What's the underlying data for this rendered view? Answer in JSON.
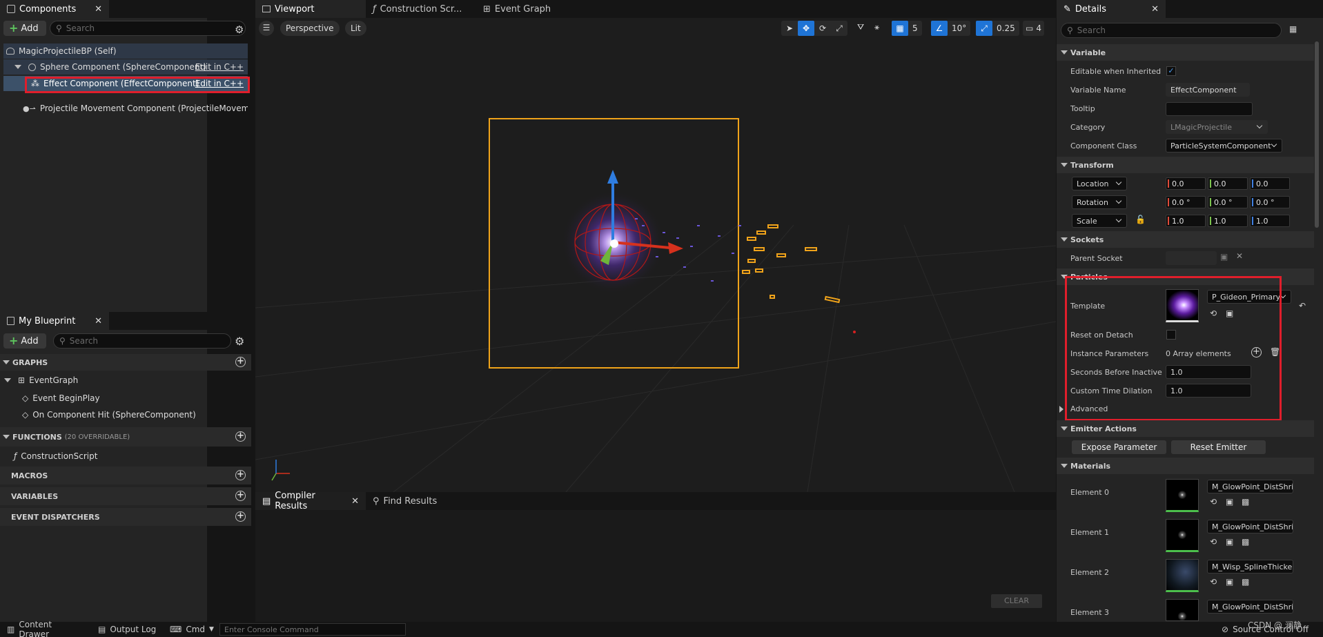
{
  "components_panel": {
    "tab_label": "Components",
    "add_label": "Add",
    "search_placeholder": "Search",
    "tree": [
      {
        "label": "MagicProjectileBP (Self)"
      },
      {
        "label": "Sphere Component (SphereComponent)",
        "link": "Edit in C++"
      },
      {
        "label": "Effect Component (EffectComponent)",
        "link": "Edit in C++"
      },
      {
        "label": "Projectile Movement Component (ProjectileMovemen"
      }
    ]
  },
  "my_blueprint": {
    "tab_label": "My Blueprint",
    "add_label": "Add",
    "search_placeholder": "Search",
    "graphs_header": "GRAPHS",
    "event_graph": "EventGraph",
    "events": [
      "Event BeginPlay",
      "On Component Hit (SphereComponent)"
    ],
    "functions_header": "FUNCTIONS",
    "functions_count": "(20 OVERRIDABLE)",
    "construction_script": "ConstructionScript",
    "macros_header": "MACROS",
    "variables_header": "VARIABLES",
    "dispatchers_header": "EVENT DISPATCHERS"
  },
  "editor_tabs": {
    "viewport": "Viewport",
    "construction": "Construction Scr...",
    "event_graph": "Event Graph"
  },
  "viewport": {
    "perspective": "Perspective",
    "lit": "Lit",
    "grid_snap": "5",
    "rotation_snap": "10°",
    "scale_snap": "0.25",
    "camera_speed": "4"
  },
  "bottom_panel": {
    "compiler_tab": "Compiler Results",
    "find_tab": "Find Results",
    "clear": "CLEAR"
  },
  "details": {
    "tab_label": "Details",
    "search_placeholder": "Search",
    "variable_section": "Variable",
    "editable_label": "Editable when Inherited",
    "variable_name_label": "Variable Name",
    "variable_name_value": "EffectComponent",
    "tooltip_label": "Tooltip",
    "category_label": "Category",
    "category_value": "LMagicProjectile",
    "component_class_label": "Component Class",
    "component_class_value": "ParticleSystemComponent",
    "transform_section": "Transform",
    "location_label": "Location",
    "rotation_label": "Rotation",
    "scale_label": "Scale",
    "location": [
      "0.0",
      "0.0",
      "0.0"
    ],
    "rotation": [
      "0.0 °",
      "0.0 °",
      "0.0 °"
    ],
    "scale": [
      "1.0",
      "1.0",
      "1.0"
    ],
    "sockets_section": "Sockets",
    "parent_socket_label": "Parent Socket",
    "particles_section": "Particles",
    "template_label": "Template",
    "template_value": "P_Gideon_Primary",
    "reset_on_detach_label": "Reset on Detach",
    "instance_params_label": "Instance Parameters",
    "instance_params_value": "0 Array elements",
    "seconds_inactive_label": "Seconds Before Inactive",
    "seconds_inactive_value": "1.0",
    "time_dilation_label": "Custom Time Dilation",
    "time_dilation_value": "1.0",
    "advanced_label": "Advanced",
    "emitter_section": "Emitter Actions",
    "expose_param": "Expose Parameter",
    "reset_emitter": "Reset Emitter",
    "materials_section": "Materials",
    "materials": [
      {
        "label": "Element 0",
        "value": "M_GlowPoint_DistShrink"
      },
      {
        "label": "Element 1",
        "value": "M_GlowPoint_DistShrink"
      },
      {
        "label": "Element 2",
        "value": "M_Wisp_SplineThicken_"
      },
      {
        "label": "Element 3",
        "value": "M_GlowPoint_DistShrink"
      }
    ]
  },
  "status_bar": {
    "content_drawer": "Content Drawer",
    "output_log": "Output Log",
    "cmd": "Cmd",
    "console_placeholder": "Enter Console Command",
    "watermark": "CSDN @ 澜静",
    "source_control": "Source Control Off"
  },
  "colors": {
    "highlight_red": "#e01e2b",
    "selection_orange": "#f0a31a",
    "accent_blue": "#1f74d6"
  }
}
